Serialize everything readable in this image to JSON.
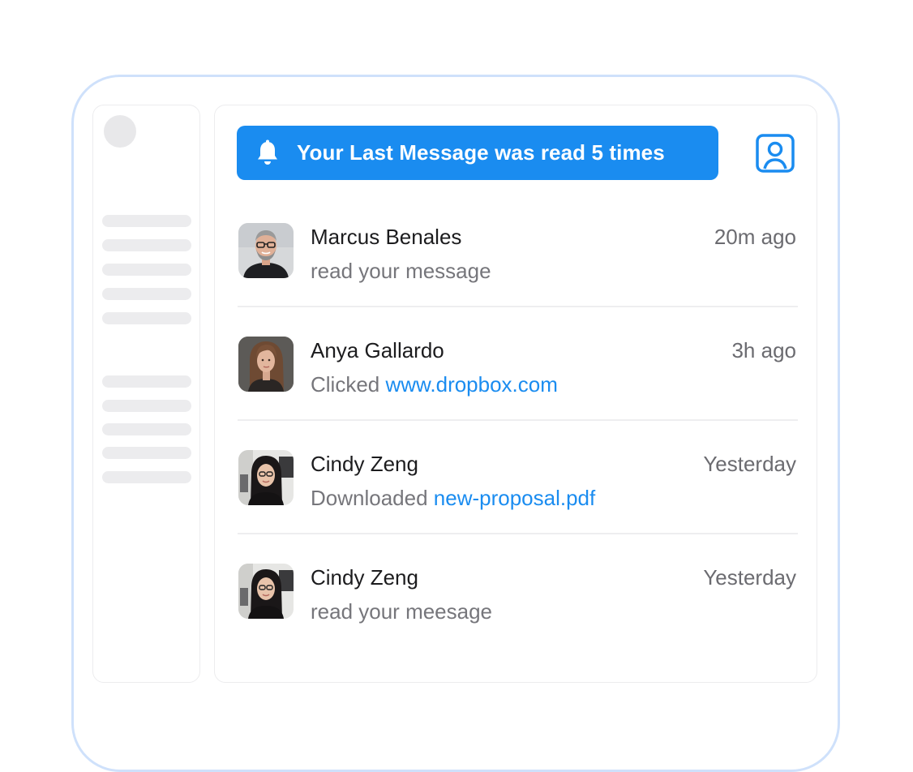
{
  "banner": {
    "icon": "bell-icon",
    "text": "Your Last Message was read 5 times",
    "color": "#1a8cf0"
  },
  "profile_icon": "profile-card-icon",
  "activity": [
    {
      "name": "Marcus Benales",
      "time": "20m ago",
      "action_prefix": "read your message",
      "action_link": ""
    },
    {
      "name": "Anya Gallardo",
      "time": "3h ago",
      "action_prefix": "Clicked ",
      "action_link": "www.dropbox.com"
    },
    {
      "name": "Cindy Zeng",
      "time": "Yesterday",
      "action_prefix": "Downloaded ",
      "action_link": "new-proposal.pdf"
    },
    {
      "name": "Cindy Zeng",
      "time": "Yesterday",
      "action_prefix": "read your meesage",
      "action_link": ""
    }
  ],
  "colors": {
    "accent": "#1a8cf0",
    "device_border": "#cfe1fb",
    "placeholder": "#ececee"
  }
}
